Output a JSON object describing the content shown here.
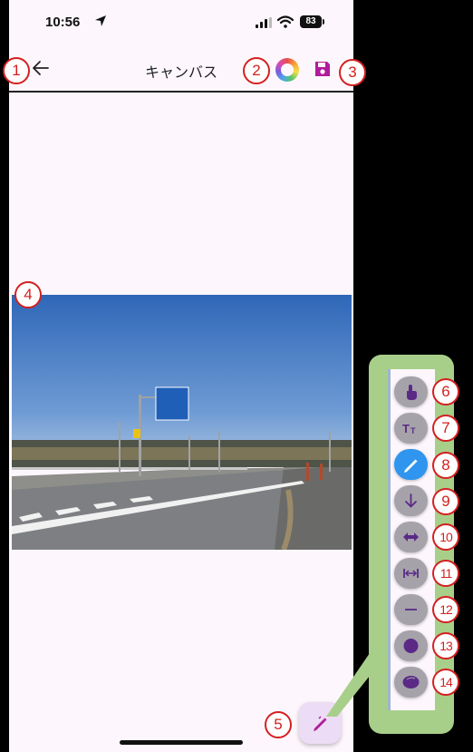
{
  "status_bar": {
    "time": "10:56",
    "battery": "83"
  },
  "app_bar": {
    "title": "キャンバス"
  },
  "annotations": [
    "1",
    "2",
    "3",
    "4",
    "5",
    "6",
    "7",
    "8",
    "9",
    "10",
    "11",
    "12",
    "13",
    "14"
  ],
  "toolbar": {
    "tools": [
      {
        "name": "select-tool",
        "icon": "tap-hand-icon"
      },
      {
        "name": "text-tool",
        "icon": "text-size-icon"
      },
      {
        "name": "pen-tool",
        "icon": "pen-icon",
        "active": true
      },
      {
        "name": "arrow-tool",
        "icon": "arrow-down-icon"
      },
      {
        "name": "double-arrow-tool",
        "icon": "double-arrow-icon"
      },
      {
        "name": "dimension-tool",
        "icon": "dimension-icon"
      },
      {
        "name": "line-tool",
        "icon": "line-icon"
      },
      {
        "name": "circle-tool",
        "icon": "circle-icon"
      },
      {
        "name": "ellipse-tool",
        "icon": "ellipse-icon"
      }
    ]
  },
  "colors": {
    "accent": "#2f95ee",
    "annotation": "#d42020",
    "callout": "#a8cf8a",
    "icon_purple": "#5b2a86",
    "save_magenta": "#b01c9a"
  }
}
